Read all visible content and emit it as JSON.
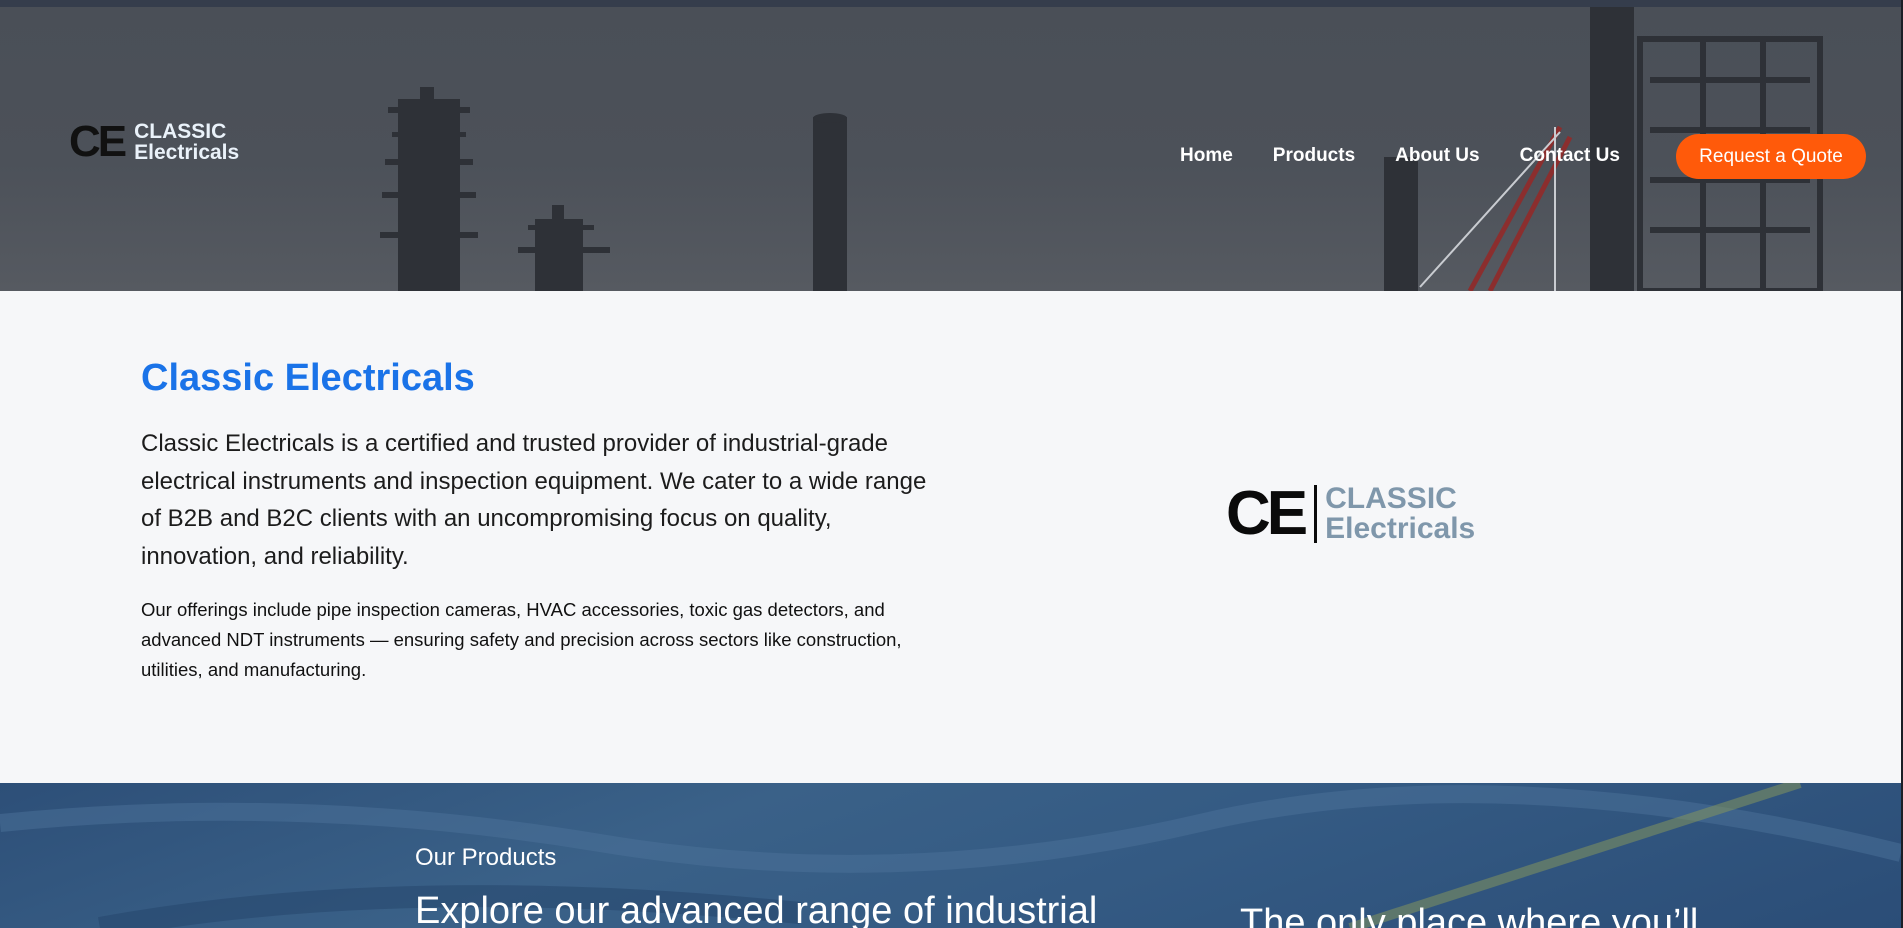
{
  "brand": {
    "mark": "CE",
    "word1": "CLASSIC",
    "word2": "Electricals"
  },
  "nav": {
    "items": [
      "Home",
      "Products",
      "About Us",
      "Contact Us"
    ],
    "cta": "Request a Quote"
  },
  "about": {
    "title": "Classic Electricals",
    "lead": "Classic Electricals is a certified and trusted provider of industrial-grade electrical instruments and inspection equipment. We cater to a wide range of B2B and B2C clients with an uncompromising focus on quality, innovation, and reliability.",
    "detail": "Our offerings include pipe inspection cameras, HVAC accessories, toxic gas detectors, and advanced NDT instruments — ensuring safety and precision across sectors like construction, utilities, and manufacturing."
  },
  "products": {
    "eyebrow": "Our Products",
    "headline": "Explore our advanced range of industrial",
    "tagline": "The only place where you’ll"
  },
  "colors": {
    "accent": "#ff5a0a",
    "title_blue": "#1a73e8",
    "logo_gray_blue": "#7f97ab"
  }
}
